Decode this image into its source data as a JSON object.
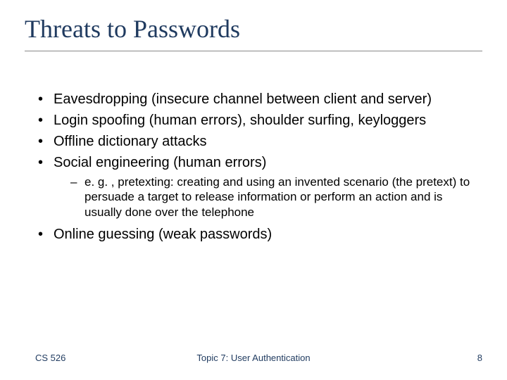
{
  "title": "Threats to Passwords",
  "bullets": {
    "b1": "Eavesdropping (insecure channel between client and server)",
    "b2": "Login spoofing (human errors), shoulder surfing, keyloggers",
    "b3": "Offline dictionary attacks",
    "b4": "Social engineering (human errors)",
    "b4_sub1": "e. g. , pretexting: creating and using an invented scenario (the pretext) to persuade a target to release information or perform an action and is usually done over the telephone",
    "b5": "Online guessing (weak passwords)"
  },
  "footer": {
    "left": "CS 526",
    "center": "Topic 7: User Authentication",
    "right": "8"
  }
}
